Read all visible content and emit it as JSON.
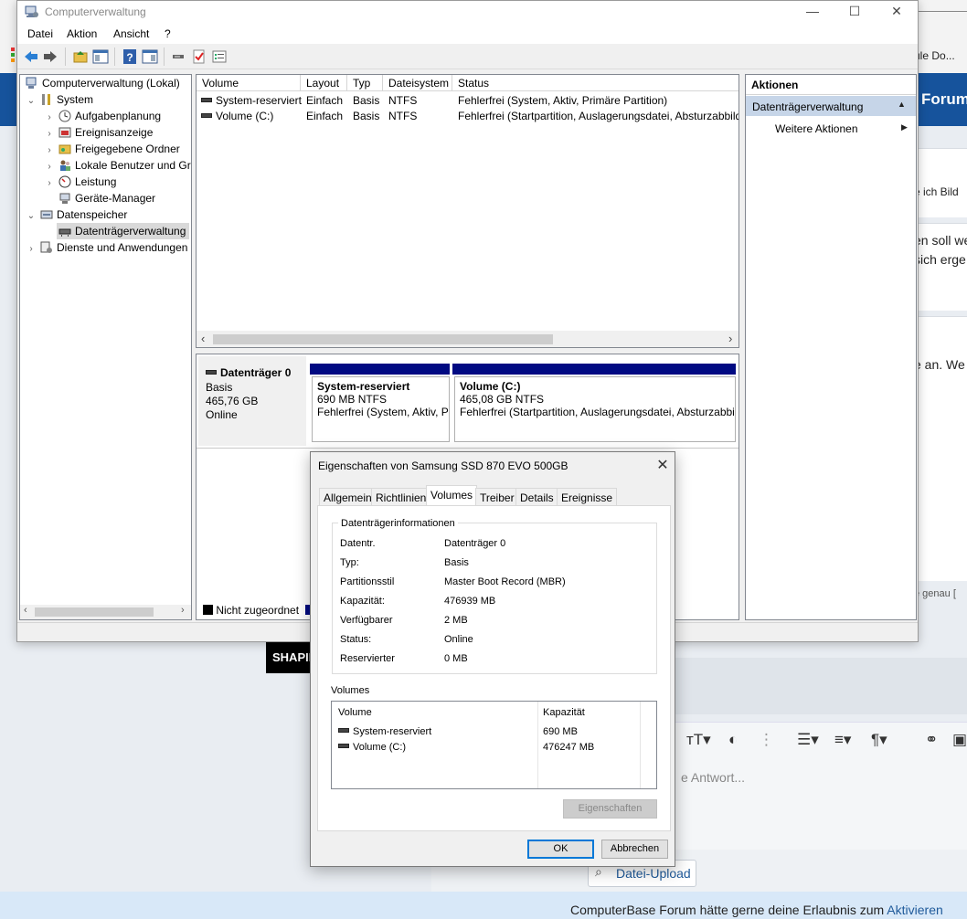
{
  "browser": {
    "tab_text": "ule Do...",
    "forum_title": "Forum",
    "text_ich_bild": "e ich Bild",
    "text_soll": "en soll we",
    "text_sich": "sich erge",
    "text_an": "e an. We",
    "text_genau": "e genau [",
    "shaping_label": "SHAPIN",
    "editor_placeholder": "e Antwort...",
    "upload_label": "Datei-Upload",
    "consent_text": "ComputerBase Forum hätte gerne deine Erlaubnis zum ",
    "consent_link": "Aktivieren"
  },
  "window": {
    "title": "Computerverwaltung",
    "minimize": "—",
    "maximize": "☐",
    "close": "✕",
    "menu": [
      "Datei",
      "Aktion",
      "Ansicht",
      "?"
    ]
  },
  "tree": {
    "items": [
      {
        "label": "Computerverwaltung (Lokal)",
        "arrow": "",
        "icon": "computer-management-icon"
      },
      {
        "label": "System",
        "arrow": "⌄",
        "icon": "tools-icon"
      },
      {
        "label": "Aufgabenplanung",
        "arrow": "›",
        "icon": "clock-icon"
      },
      {
        "label": "Ereignisanzeige",
        "arrow": "›",
        "icon": "event-viewer-icon"
      },
      {
        "label": "Freigegebene Ordner",
        "arrow": "›",
        "icon": "shared-folder-icon"
      },
      {
        "label": "Lokale Benutzer und Gruppen",
        "arrow": "›",
        "icon": "users-icon"
      },
      {
        "label": "Leistung",
        "arrow": "›",
        "icon": "performance-icon"
      },
      {
        "label": "Geräte-Manager",
        "arrow": "",
        "icon": "device-manager-icon"
      },
      {
        "label": "Datenspeicher",
        "arrow": "⌄",
        "icon": "storage-icon"
      },
      {
        "label": "Datenträgerverwaltung",
        "arrow": "",
        "icon": "disk-management-icon"
      },
      {
        "label": "Dienste und Anwendungen",
        "arrow": "›",
        "icon": "services-icon"
      }
    ]
  },
  "volume_list": {
    "columns": [
      "Volume",
      "Layout",
      "Typ",
      "Dateisystem",
      "Status"
    ],
    "rows": [
      {
        "volume": "System-reserviert",
        "layout": "Einfach",
        "typ": "Basis",
        "fs": "NTFS",
        "status": "Fehlerfrei (System, Aktiv, Primäre Partition)"
      },
      {
        "volume": "Volume (C:)",
        "layout": "Einfach",
        "typ": "Basis",
        "fs": "NTFS",
        "status": "Fehlerfrei (Startpartition, Auslagerungsdatei, Absturzabbild, Primäre Partition)"
      }
    ]
  },
  "disk_map": {
    "disk_name": "Datenträger 0",
    "disk_type": "Basis",
    "disk_size": "465,76 GB",
    "disk_state": "Online",
    "partitions": [
      {
        "name": "System-reserviert",
        "size": "690 MB NTFS",
        "status": "Fehlerfrei (System, Aktiv, Primäre Partition)"
      },
      {
        "name": "Volume  (C:)",
        "size": "465,08 GB NTFS",
        "status": "Fehlerfrei (Startpartition, Auslagerungsdatei, Absturzabbild, Primäre Partition)"
      }
    ],
    "legend_unallocated": "Nicht zugeordnet"
  },
  "actions": {
    "header": "Aktionen",
    "section": "Datenträgerverwaltung",
    "more": "Weitere Aktionen"
  },
  "dialog": {
    "title": "Eigenschaften von Samsung SSD 870 EVO 500GB",
    "tabs": [
      "Allgemein",
      "Richtlinien",
      "Volumes",
      "Treiber",
      "Details",
      "Ereignisse"
    ],
    "active_tab": "Volumes",
    "group_title": "Datenträgerinformationen",
    "info": [
      {
        "label": "Datentr.",
        "value": "Datenträger 0"
      },
      {
        "label": "Typ:",
        "value": "Basis"
      },
      {
        "label": "Partitionsstil",
        "value": "Master Boot Record (MBR)"
      },
      {
        "label": "Kapazität:",
        "value": "476939 MB"
      },
      {
        "label": "Verfügbarer",
        "value": "2 MB"
      },
      {
        "label": "Status:",
        "value": "Online"
      },
      {
        "label": "Reservierter",
        "value": "0 MB"
      }
    ],
    "volumes_caption": "Volumes",
    "volumes_columns": [
      "Volume",
      "Kapazität"
    ],
    "volumes": [
      {
        "name": "System-reserviert",
        "capacity": "690 MB"
      },
      {
        "name": "Volume (C:)",
        "capacity": "476247 MB"
      }
    ],
    "properties_button": "Eigenschaften",
    "ok_button": "OK",
    "cancel_button": "Abbrechen"
  }
}
